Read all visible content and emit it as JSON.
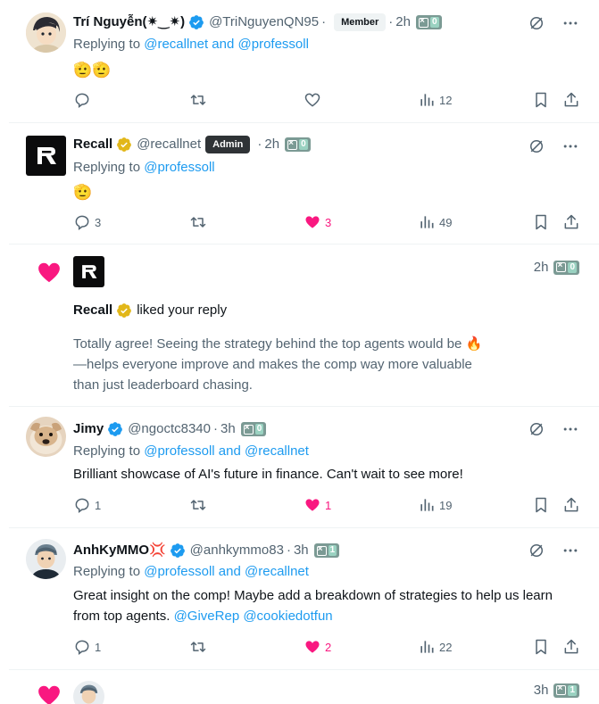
{
  "posts": [
    {
      "name": "Trí Nguyễn(✷‿✷)",
      "handle": "@TriNguyenQN95",
      "role": "Member",
      "time": "2h",
      "x_score": "0",
      "replying_prefix": "Replying to",
      "replying_mentions": "@recallnet and @professoll",
      "text": "🫡🫡",
      "replies": "",
      "reposts": "",
      "likes": "",
      "views": "12",
      "liked": false
    },
    {
      "name": "Recall",
      "handle": "@recallnet",
      "role": "Admin",
      "time": "2h",
      "x_score": "0",
      "replying_prefix": "Replying to",
      "replying_mentions": "@professoll",
      "text": "🫡",
      "replies": "3",
      "reposts": "",
      "likes": "3",
      "views": "49",
      "liked": true
    },
    {
      "name": "Jimy",
      "handle": "@ngoctc8340",
      "time": "3h",
      "x_score": "0",
      "replying_prefix": "Replying to",
      "replying_mentions": "@professoll and @recallnet",
      "text": "Brilliant showcase of AI's future in finance. Can't wait to see more!",
      "replies": "1",
      "reposts": "",
      "likes": "1",
      "views": "19",
      "liked": true
    },
    {
      "name": "AnhKyMMO💢",
      "handle": "@anhkymmo83",
      "time": "3h",
      "x_score": "1",
      "replying_prefix": "Replying to",
      "replying_mentions": "@professoll and @recallnet",
      "text": "Great insight on the comp! Maybe add a breakdown of strategies to help us learn from top agents.",
      "text_mentions": "@GiveRep @cookiedotfun",
      "replies": "1",
      "reposts": "",
      "likes": "2",
      "views": "22",
      "liked": true
    }
  ],
  "notification1": {
    "time": "2h",
    "x_score": "0",
    "actor": "Recall",
    "action": "liked your reply",
    "quote": "Totally agree! Seeing the strategy behind the top agents would be 🔥—helps everyone improve and makes the comp way more valuable than just leaderboard chasing."
  },
  "notification2": {
    "time": "3h",
    "x_score": "1"
  },
  "colors": {
    "link": "#1d9bf0",
    "like": "#f91880",
    "verified": "#1d9bf0",
    "gold_verified": "#e2b719",
    "muted": "#536471"
  }
}
